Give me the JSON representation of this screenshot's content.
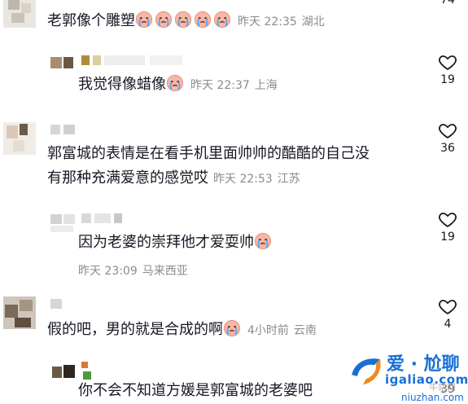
{
  "comments": [
    {
      "text": "老郭像个雕塑",
      "emoji_count": 5,
      "emoji": "crying-face",
      "date": "昨天 22:35",
      "location": "湖北",
      "likes": "74"
    },
    {
      "text": "我觉得像蜡像",
      "emoji_count": 1,
      "emoji": "crying-face",
      "date": "昨天 22:37",
      "location": "上海",
      "likes": "19"
    },
    {
      "line1": "郭富城的表情是在看手机里面帅帅的酷酷的自己没",
      "line2": "有那种充满爱意的感觉哎",
      "date": "昨天 22:53",
      "location": "江苏",
      "likes": "36"
    },
    {
      "text": "因为老婆的崇拜他才爱耍帅",
      "emoji_count": 1,
      "emoji": "crying-face",
      "date": "昨天 23:09",
      "location": "马来西亚",
      "likes": "19"
    },
    {
      "text": "假的吧，男的就是合成的啊",
      "emoji_count": 1,
      "emoji": "crying-face",
      "date": "4小时前",
      "location": "云南",
      "likes": "4"
    },
    {
      "text": "你不会不知道方媛是郭富城的老婆吧",
      "likes": "39"
    }
  ],
  "watermark": {
    "brand": "爱 · 尬聊",
    "url": "igaliao.com",
    "site": "牛站网",
    "site_url": "niuzhan.com"
  },
  "colors": {
    "text": "#161823",
    "meta": "#8a8b91",
    "brand_blue": "#1a6fd6",
    "brand_orange": "#f08a1c"
  }
}
